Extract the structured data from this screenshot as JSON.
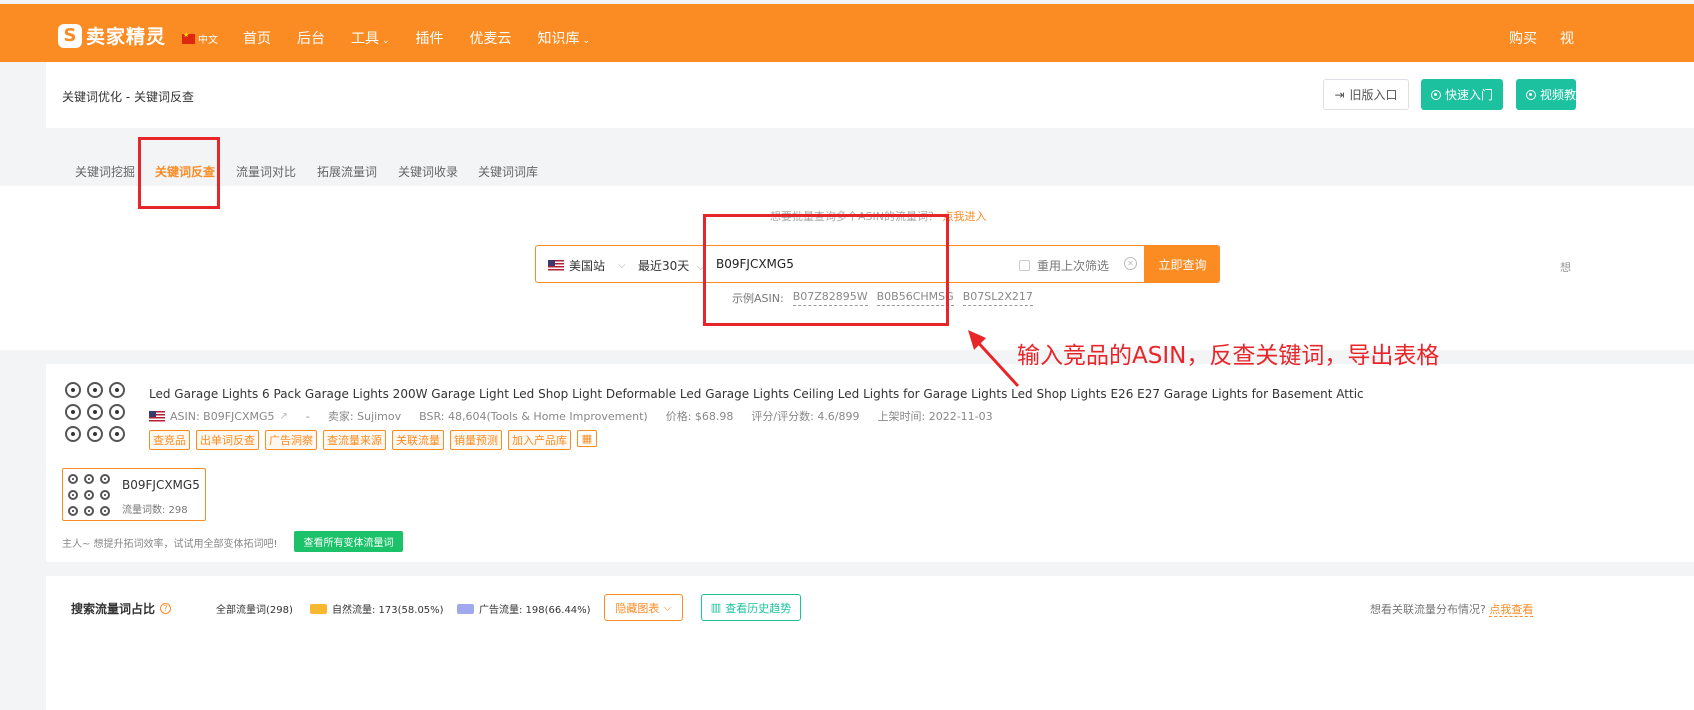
{
  "topbar": {
    "brand": "卖家精灵",
    "logo_letter": "S",
    "lang": "中文",
    "nav": [
      {
        "label": "首页",
        "dropdown": false
      },
      {
        "label": "后台",
        "dropdown": false
      },
      {
        "label": "工具",
        "dropdown": true
      },
      {
        "label": "插件",
        "dropdown": false
      },
      {
        "label": "优麦云",
        "dropdown": false
      },
      {
        "label": "知识库",
        "dropdown": true
      }
    ],
    "right": [
      "购买",
      "视"
    ],
    "bg_color": "#fb8c24"
  },
  "header": {
    "breadcrumb": "关键词优化 - 关键词反查",
    "old_entry": "旧版入口",
    "quick_start": "快速入门",
    "video": "视频教"
  },
  "tabs": [
    {
      "label": "关键词挖掘",
      "active": false
    },
    {
      "label": "关键词反查",
      "active": true
    },
    {
      "label": "流量词对比",
      "active": false
    },
    {
      "label": "拓展流量词",
      "active": false
    },
    {
      "label": "关键词收录",
      "active": false
    },
    {
      "label": "关键词词库",
      "active": false
    }
  ],
  "search": {
    "batch_prompt": "想要批量查询多个ASIN的流量词？",
    "batch_link": "点我进入",
    "site": "美国站",
    "period": "最近30天",
    "asin_value": "B09FJCXMG5",
    "reuse_filter": "重用上次筛选",
    "submit": "立即查询",
    "examples_label": "示例ASIN:",
    "examples": [
      "B07Z82895W",
      "B0B56CHMSG",
      "B07SL2X217"
    ],
    "edge_text": "想"
  },
  "annotation": "输入竞品的ASIN，反查关键词，导出表格",
  "product": {
    "title": "Led Garage Lights 6 Pack Garage Lights 200W Garage Light Led Shop Light Deformable Led Garage Lights Ceiling Led Lights for Garage Lights Led Shop Lights E26 E27 Garage Lights for Basement Attic",
    "asin": "ASIN: B09FJCXMG5",
    "dash": "-",
    "seller": "卖家: Sujimov",
    "bsr": "BSR: 48,604(Tools & Home Improvement)",
    "price": "价格: $68.98",
    "rating": "评分/评分数: 4.6/899",
    "listed": "上架时间: 2022-11-03",
    "tags": [
      "查竞品",
      "出单词反查",
      "广告洞察",
      "查流量来源",
      "关联流量",
      "销量预测",
      "加入产品库"
    ],
    "variant_asin": "B09FJCXMG5",
    "variant_count": "流量词数: 298",
    "hint": "主人~ 想提升拓词效率，试试用全部变体拓词吧!",
    "hint_button": "查看所有变体流量词"
  },
  "stats": {
    "title": "搜索流量词占比",
    "all": "全部流量词(298)",
    "natural": "自然流量: 173(58.05%)",
    "ads": "广告流量: 198(66.44%)",
    "natural_color": "#f7b731",
    "ads_color": "#a0a8f0",
    "hide_chart": "隐藏图表",
    "history": "查看历史趋势",
    "right_text": "想看关联流量分布情况?",
    "right_link": "点我查看"
  }
}
